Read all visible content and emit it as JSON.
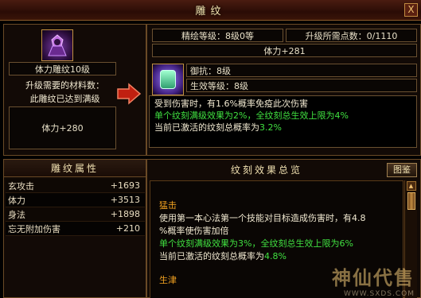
{
  "window": {
    "title": "雕纹",
    "close": "X"
  },
  "left": {
    "name_plate": "体力雕纹10级",
    "materials_label": "升级需要的材料数：",
    "materials_value": "此雕纹已达到满级",
    "current_stat": "体力+280"
  },
  "top_right": {
    "refine_level": "精绘等级：8级0等",
    "upgrade_points": "升级所需点数：0/1110",
    "stat_bonus": "体力+281",
    "resist": "御抗：8级",
    "effect_level": "生效等级：8级"
  },
  "description": {
    "line1": "受到伤害时，有1.6%概率免疫此次伤害",
    "line2": "单个纹刻满级效果为2%，全纹刻总生效上限为4%",
    "line3_prefix": "当前已激活的纹刻总概率为",
    "line3_value": "3.2%"
  },
  "attributes": {
    "header": "雕纹属性",
    "rows": [
      {
        "name": "玄攻击",
        "value": "+1693"
      },
      {
        "name": "体力",
        "value": "+3513"
      },
      {
        "name": "身法",
        "value": "+1898"
      },
      {
        "name": "忘无附加伤害",
        "value": "+210"
      }
    ]
  },
  "overview": {
    "header": "纹刻效果总览",
    "guide_button": "图鉴",
    "effects": [
      {
        "title": "猛击",
        "line1": "使用第一本心法第一个技能对目标造成伤害时，有4.8",
        "line2": "%概率使伤害加倍",
        "line3": "单个纹刻满级效果为3%，全纹刻总生效上限为6%",
        "line4_prefix": "当前已激活的纹刻总概率为",
        "line4_value": "4.8%"
      },
      {
        "title": "生津"
      }
    ]
  },
  "watermark": {
    "brand": "神仙代售",
    "url": "WWW.SXDS.COM"
  },
  "colors": {
    "accent_green": "#40e040",
    "title_orange": "#f0a020",
    "highlight_red": "#f03020"
  },
  "icons": [
    "avatar-portrait",
    "carving-gem-icon",
    "red-arrow-icon",
    "scroll-up-icon",
    "scroll-down-icon",
    "close-icon"
  ]
}
